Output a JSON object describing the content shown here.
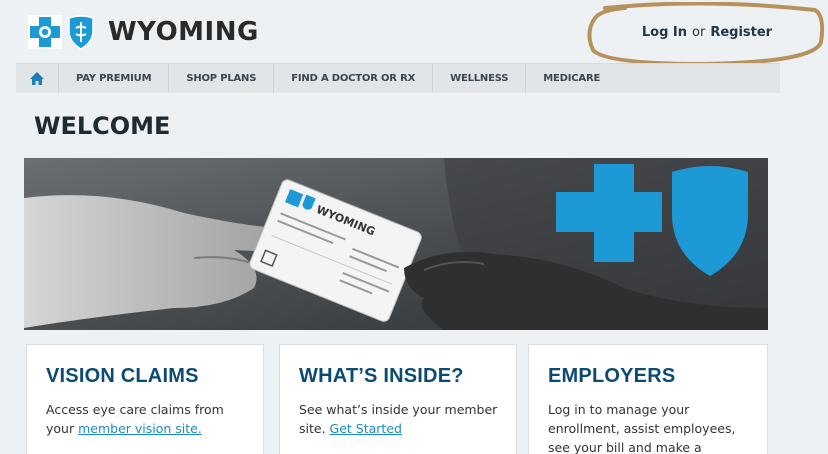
{
  "header": {
    "brand": "WYOMING",
    "login_label": "Log In",
    "or_label": "or",
    "register_label": "Register"
  },
  "nav": {
    "items": [
      "PAY PREMIUM",
      "SHOP PLANS",
      "FIND A DOCTOR OR RX",
      "WELLNESS",
      "MEDICARE"
    ]
  },
  "main": {
    "title": "WELCOME"
  },
  "hero": {
    "card_brand": "WYOMING"
  },
  "cards": [
    {
      "title": "VISION CLAIMS",
      "text_before": "Access eye care claims from your ",
      "link": "member vision site.",
      "text_after": ""
    },
    {
      "title": "WHAT’S INSIDE?",
      "text_before": "See what’s inside your member site. ",
      "link": "Get Started",
      "text_after": ""
    },
    {
      "title": "EMPLOYERS",
      "text_before": "Log in to manage your enrollment, assist employees, see your bill and make a payment.",
      "link": "",
      "text_after": ""
    }
  ],
  "colors": {
    "brand_blue": "#1d9ad6",
    "heading_blue": "#0b4b73",
    "link_blue": "#1a8ac8",
    "annotation_ring": "#b8925c"
  }
}
